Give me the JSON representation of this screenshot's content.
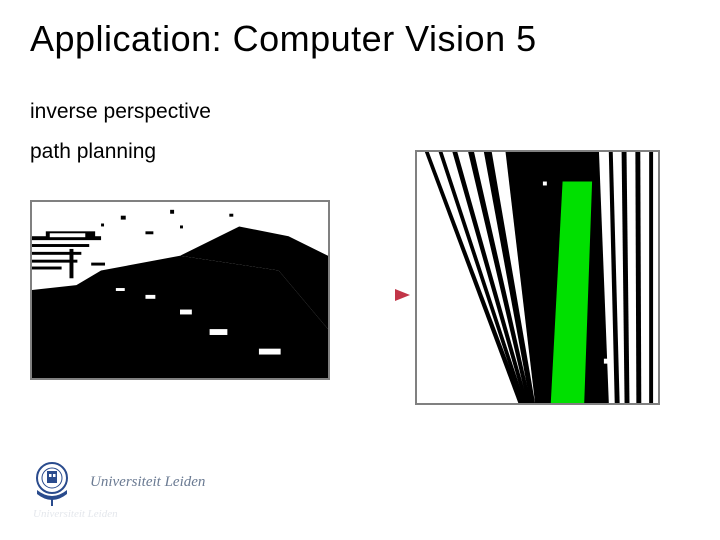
{
  "title": "Application: Computer Vision 5",
  "lines": {
    "l1": "inverse perspective",
    "l2": "path planning"
  },
  "logo": {
    "text": "Universiteit Leiden",
    "shadow": "Universiteit Leiden"
  },
  "colors": {
    "accent_green": "#00e000",
    "arrow_fill": "#d44a5a",
    "logo_blue": "#2a4b8d",
    "logo_text": "#6a7a92"
  },
  "images": {
    "left_alt": "binary road perspective image",
    "right_alt": "inverse perspective map with green detected path"
  }
}
